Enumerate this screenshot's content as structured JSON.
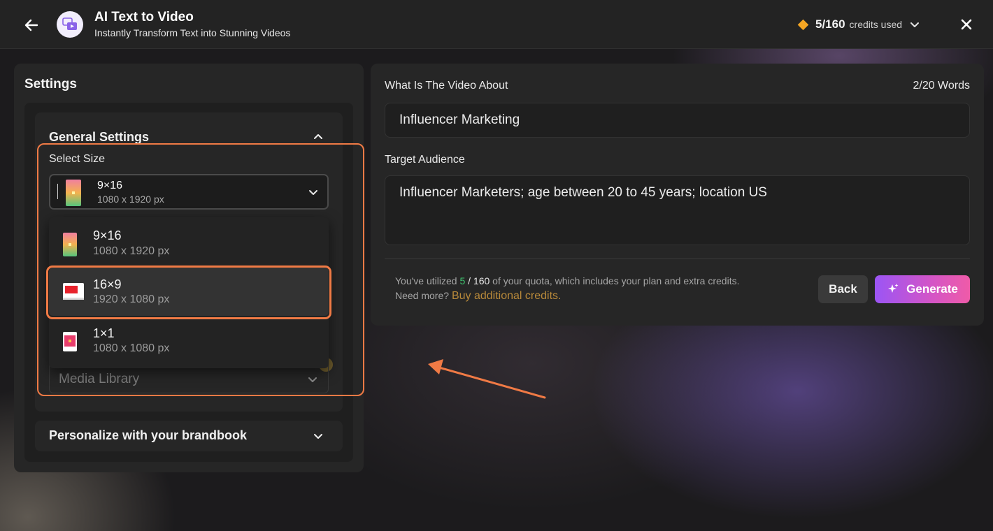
{
  "header": {
    "title": "AI Text to Video",
    "subtitle": "Instantly Transform Text into Stunning Videos",
    "credits_count": "5/160",
    "credits_label": "credits used"
  },
  "settings": {
    "title": "Settings",
    "general_title": "General Settings",
    "select_size_label": "Select Size",
    "selected_size": {
      "name": "9×16",
      "dim": "1080 x 1920 px"
    },
    "size_options": [
      {
        "name": "9×16",
        "dim": "1080 x 1920 px"
      },
      {
        "name": "16×9",
        "dim": "1920 x 1080 px"
      },
      {
        "name": "1×1",
        "dim": "1080 x 1080 px"
      }
    ],
    "media_label": "Media Library",
    "brandbook_title": "Personalize with your brandbook"
  },
  "form": {
    "topic_label": "What Is The Video About",
    "word_count": "2/20 Words",
    "topic_value": "Influencer Marketing",
    "audience_label": "Target Audience",
    "audience_value": "Influencer Marketers; age between 20 to 45 years; location US",
    "quota_prefix": "You've utilized ",
    "quota_used": "5",
    "quota_sep": " / ",
    "quota_total": "160",
    "quota_suffix": " of your quota, which includes your plan and extra credits.",
    "need_more": "Need more? ",
    "buy_link": "Buy additional credits.",
    "back_label": "Back",
    "generate_label": "Generate"
  },
  "colors": {
    "accent_orange": "#f07a45",
    "credit_diamond": "#f5a623",
    "quota_green": "#3fc36f",
    "generate_gradient": [
      "#9b55f5",
      "#ef5ba8"
    ]
  }
}
